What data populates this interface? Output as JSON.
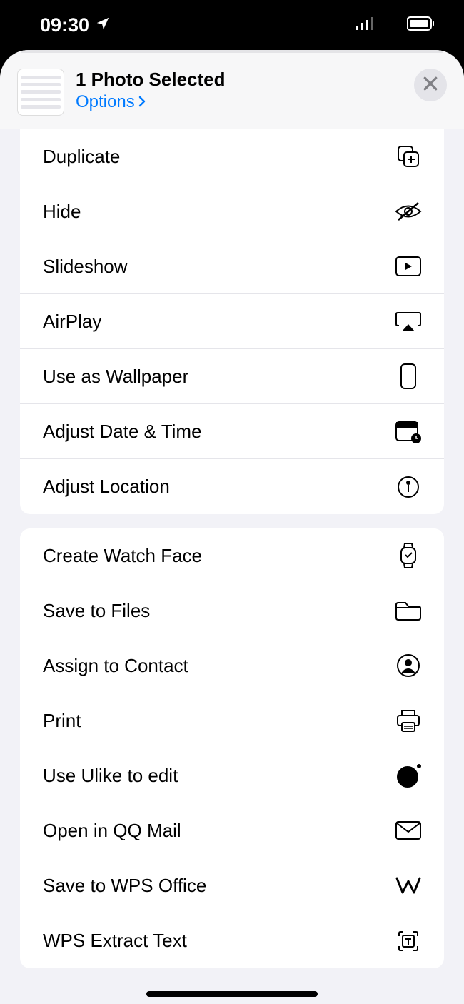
{
  "status": {
    "time": "09:30"
  },
  "header": {
    "title": "1 Photo Selected",
    "options": "Options"
  },
  "group1": [
    {
      "label": "Duplicate",
      "icon": "duplicate-icon"
    },
    {
      "label": "Hide",
      "icon": "hide-icon"
    },
    {
      "label": "Slideshow",
      "icon": "slideshow-icon"
    },
    {
      "label": "AirPlay",
      "icon": "airplay-icon"
    },
    {
      "label": "Use as Wallpaper",
      "icon": "wallpaper-icon"
    },
    {
      "label": "Adjust Date & Time",
      "icon": "calendar-icon"
    },
    {
      "label": "Adjust Location",
      "icon": "location-icon"
    }
  ],
  "group2": [
    {
      "label": "Create Watch Face",
      "icon": "watch-icon"
    },
    {
      "label": "Save to Files",
      "icon": "folder-icon"
    },
    {
      "label": "Assign to Contact",
      "icon": "contact-icon"
    },
    {
      "label": "Print",
      "icon": "print-icon"
    },
    {
      "label": "Use Ulike to edit",
      "icon": "ulike-icon"
    },
    {
      "label": "Open in QQ Mail",
      "icon": "mail-icon"
    },
    {
      "label": "Save to WPS Office",
      "icon": "wps-icon"
    },
    {
      "label": "WPS Extract Text",
      "icon": "extract-icon"
    }
  ]
}
